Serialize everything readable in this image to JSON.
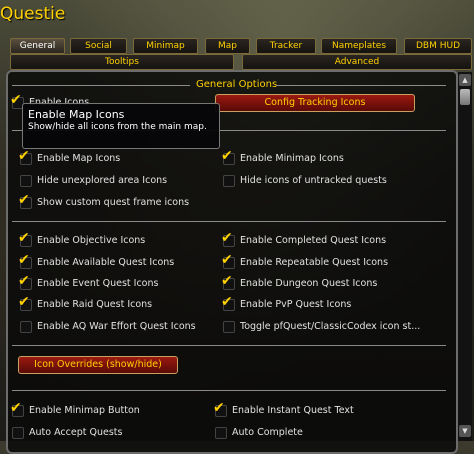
{
  "window": {
    "title": "Questie"
  },
  "tabs": [
    {
      "label": "General",
      "active": true
    },
    {
      "label": "Social"
    },
    {
      "label": "Minimap"
    },
    {
      "label": "Map"
    },
    {
      "label": "Tracker"
    },
    {
      "label": "Nameplates"
    },
    {
      "label": "DBM HUD"
    },
    {
      "label": "Tooltips"
    },
    {
      "label": "Advanced"
    }
  ],
  "section": {
    "title": "General Options"
  },
  "top": {
    "enable_icons_label": "Enable Icons",
    "enable_icons_checked": true,
    "config_tracking_button": "Config Tracking Icons"
  },
  "tooltip": {
    "title": "Enable Map Icons",
    "body": "Show/hide all icons from the main map."
  },
  "options": [
    {
      "label": "Enable Map Icons",
      "checked": true
    },
    {
      "label": "Enable Minimap Icons",
      "checked": true
    },
    {
      "label": "Hide unexplored area Icons",
      "checked": false
    },
    {
      "label": "Hide icons of untracked quests",
      "checked": false
    },
    {
      "label": "Show custom quest frame icons",
      "checked": true
    },
    {
      "label": "Enable Objective Icons",
      "checked": true
    },
    {
      "label": "Enable Completed Quest Icons",
      "checked": true
    },
    {
      "label": "Enable Available Quest Icons",
      "checked": true
    },
    {
      "label": "Enable Repeatable Quest Icons",
      "checked": true
    },
    {
      "label": "Enable Event Quest Icons",
      "checked": true
    },
    {
      "label": "Enable Dungeon Quest Icons",
      "checked": true
    },
    {
      "label": "Enable Raid Quest Icons",
      "checked": true
    },
    {
      "label": "Enable PvP Quest Icons",
      "checked": true
    },
    {
      "label": "Enable AQ War Effort Quest Icons",
      "checked": false
    },
    {
      "label": "Toggle pfQuest/ClassicCodex icon st...",
      "checked": false
    },
    {
      "label": "Enable Minimap Button",
      "checked": true
    },
    {
      "label": "Enable Instant Quest Text",
      "checked": true
    },
    {
      "label": "Auto Accept Quests",
      "checked": false
    },
    {
      "label": "Auto Complete",
      "checked": false
    }
  ],
  "icon_overrides_button": "Icon Overrides (show/hide)",
  "icons": {
    "check": "checkmark-icon",
    "scroll_up": "scroll-up-icon",
    "scroll_down": "scroll-down-icon"
  },
  "colors": {
    "accent_gold": "#ffd100",
    "button_red": "#8a1208",
    "tooltip_bg": "#06060a"
  }
}
